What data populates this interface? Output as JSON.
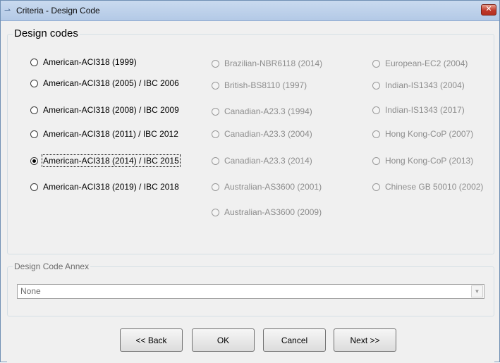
{
  "window": {
    "title": "Criteria - Design Code",
    "close_label": "✕"
  },
  "design_codes": {
    "legend": "Design codes",
    "options": [
      {
        "label": "American-ACI318 (1999)",
        "checked": false,
        "enabled": true
      },
      {
        "label": "American-ACI318 (2005) / IBC 2006",
        "checked": false,
        "enabled": true
      },
      {
        "label": "American-ACI318 (2008) / IBC 2009",
        "checked": false,
        "enabled": true
      },
      {
        "label": "American-ACI318 (2011) / IBC 2012",
        "checked": false,
        "enabled": true
      },
      {
        "label": "American-ACI318 (2014) / IBC 2015",
        "checked": true,
        "enabled": true
      },
      {
        "label": "American-ACI318 (2019) / IBC 2018",
        "checked": false,
        "enabled": true
      },
      {
        "label": "Brazilian-NBR6118 (2014)",
        "checked": false,
        "enabled": false
      },
      {
        "label": "British-BS8110 (1997)",
        "checked": false,
        "enabled": false
      },
      {
        "label": "Canadian-A23.3 (1994)",
        "checked": false,
        "enabled": false
      },
      {
        "label": "Canadian-A23.3 (2004)",
        "checked": false,
        "enabled": false
      },
      {
        "label": "Canadian-A23.3 (2014)",
        "checked": false,
        "enabled": false
      },
      {
        "label": "Australian-AS3600 (2001)",
        "checked": false,
        "enabled": false
      },
      {
        "label": "Australian-AS3600 (2009)",
        "checked": false,
        "enabled": false
      },
      {
        "label": "European-EC2 (2004)",
        "checked": false,
        "enabled": false
      },
      {
        "label": "Indian-IS1343 (2004)",
        "checked": false,
        "enabled": false
      },
      {
        "label": "Indian-IS1343 (2017)",
        "checked": false,
        "enabled": false
      },
      {
        "label": "Hong Kong-CoP (2007)",
        "checked": false,
        "enabled": false
      },
      {
        "label": "Hong Kong-CoP (2013)",
        "checked": false,
        "enabled": false
      },
      {
        "label": "Chinese GB 50010 (2002)",
        "checked": false,
        "enabled": false
      }
    ]
  },
  "annex": {
    "legend": "Design Code Annex",
    "selected": "None"
  },
  "buttons": {
    "back": "<< Back",
    "ok": "OK",
    "cancel": "Cancel",
    "next": "Next >>"
  }
}
